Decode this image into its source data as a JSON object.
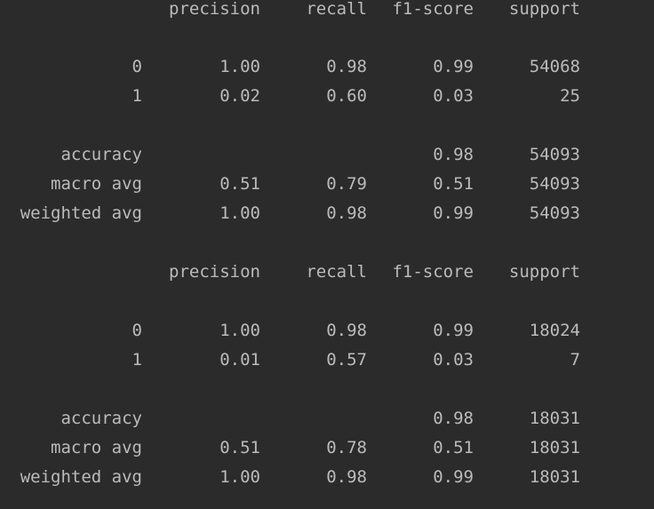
{
  "reports": [
    {
      "headers": [
        "precision",
        "recall",
        "f1-score",
        "support"
      ],
      "rows": [
        [
          "0",
          "1.00",
          "0.98",
          "0.99",
          "54068"
        ],
        [
          "1",
          "0.02",
          "0.60",
          "0.03",
          "25"
        ]
      ],
      "summary": [
        [
          "accuracy",
          "",
          "",
          "0.98",
          "54093"
        ],
        [
          "macro avg",
          "0.51",
          "0.79",
          "0.51",
          "54093"
        ],
        [
          "weighted avg",
          "1.00",
          "0.98",
          "0.99",
          "54093"
        ]
      ]
    },
    {
      "headers": [
        "precision",
        "recall",
        "f1-score",
        "support"
      ],
      "rows": [
        [
          "0",
          "1.00",
          "0.98",
          "0.99",
          "18024"
        ],
        [
          "1",
          "0.01",
          "0.57",
          "0.03",
          "7"
        ]
      ],
      "summary": [
        [
          "accuracy",
          "",
          "",
          "0.98",
          "18031"
        ],
        [
          "macro avg",
          "0.51",
          "0.78",
          "0.51",
          "18031"
        ],
        [
          "weighted avg",
          "1.00",
          "0.98",
          "0.99",
          "18031"
        ]
      ]
    }
  ]
}
